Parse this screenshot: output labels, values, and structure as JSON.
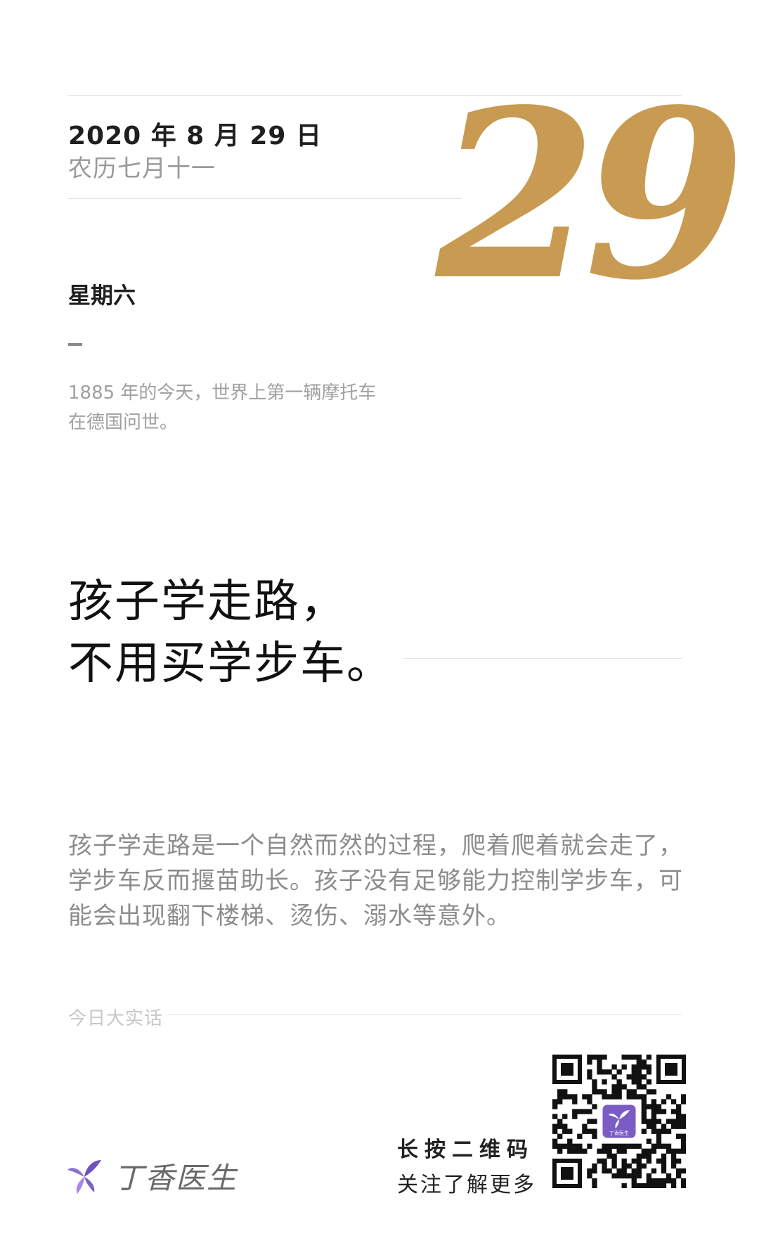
{
  "header": {
    "date": "2020 年 8 月 29 日",
    "lunar": "农历七月十一",
    "day_number": "29",
    "weekday": "星期六"
  },
  "history": {
    "line1": "1885 年的今天，世界上第一辆摩托车",
    "line2": "在德国问世。"
  },
  "headline": {
    "line1": "孩子学走路，",
    "line2": "不用买学步车。"
  },
  "body": {
    "line1": "孩子学走路是一个自然而然的过程，爬着爬着就会走了，",
    "line2": "学步车反而揠苗助长。孩子没有足够能力控制学步车，可",
    "line3": "能会出现翻下楼梯、烫伤、溺水等意外。"
  },
  "section_label": "今日大实话",
  "brand": {
    "name": "丁香医生",
    "qr_badge": "丁香医生"
  },
  "cta": {
    "line1": "长按二维码",
    "line2": "关注了解更多"
  },
  "colors": {
    "accent_gold": "#c89a52",
    "brand_purple": "#7a5cc4"
  }
}
